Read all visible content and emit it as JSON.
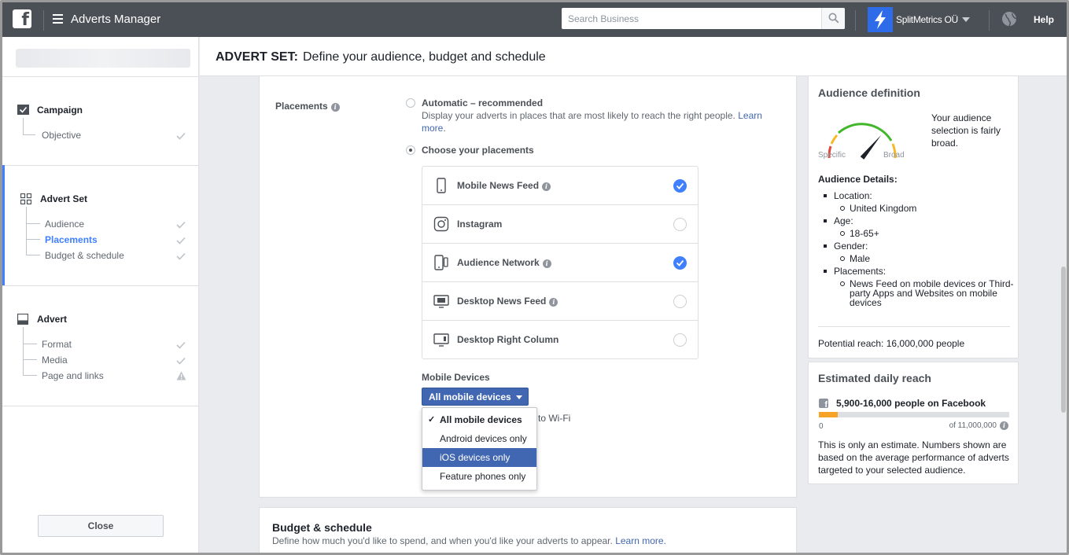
{
  "topbar": {
    "logo_letter": "f",
    "app_title": "Adverts Manager",
    "search_placeholder": "Search Business",
    "account_name": "SplitMetrics OÜ",
    "help_label": "Help"
  },
  "sidebar": {
    "sections": [
      {
        "label": "Campaign",
        "items": [
          {
            "label": "Objective",
            "status": "done"
          }
        ]
      },
      {
        "label": "Advert Set",
        "items": [
          {
            "label": "Audience",
            "status": "done"
          },
          {
            "label": "Placements",
            "status": "done",
            "active": true
          },
          {
            "label": "Budget & schedule",
            "status": "done"
          }
        ]
      },
      {
        "label": "Advert",
        "items": [
          {
            "label": "Format",
            "status": "done"
          },
          {
            "label": "Media",
            "status": "done"
          },
          {
            "label": "Page and links",
            "status": "warning"
          }
        ]
      }
    ],
    "close_label": "Close"
  },
  "header": {
    "prefix": "ADVERT SET:",
    "title": "Define your audience, budget and schedule"
  },
  "placements": {
    "label": "Placements",
    "automatic": {
      "title": "Automatic – recommended",
      "desc": "Display your adverts in places that are most likely to reach the right people.",
      "link": "Learn more",
      "link_suffix": "."
    },
    "choose_title": "Choose your placements",
    "options": [
      {
        "label": "Mobile News Feed",
        "info": true,
        "checked": true,
        "icon": "phone-icon"
      },
      {
        "label": "Instagram",
        "info": false,
        "checked": false,
        "icon": "instagram-icon"
      },
      {
        "label": "Audience Network",
        "info": true,
        "checked": true,
        "icon": "audience-network-icon"
      },
      {
        "label": "Desktop News Feed",
        "info": true,
        "checked": false,
        "icon": "desktop-icon"
      },
      {
        "label": "Desktop Right Column",
        "info": false,
        "checked": false,
        "icon": "desktop-right-column-icon"
      }
    ],
    "mobile_devices_label": "Mobile Devices",
    "mobile_devices_selected": "All mobile devices",
    "mobile_devices_options": [
      {
        "label": "All mobile devices",
        "selected": true
      },
      {
        "label": "Android devices only"
      },
      {
        "label": "iOS devices only",
        "highlighted": true
      },
      {
        "label": "Feature phones only"
      }
    ],
    "wifi_partial": "d to Wi-Fi"
  },
  "budget": {
    "title": "Budget & schedule",
    "desc": "Define how much you'd like to spend, and when you'd like your adverts to appear.",
    "link": "Learn more."
  },
  "audience_definition": {
    "title": "Audience definition",
    "gauge_left": "Specific",
    "gauge_right": "Broad",
    "gauge_level": 0.72,
    "summary": "Your audience selection is fairly broad.",
    "details_title": "Audience Details:",
    "details": [
      {
        "label": "Location:",
        "values": [
          "United Kingdom"
        ]
      },
      {
        "label": "Age:",
        "values": [
          "18-65+"
        ]
      },
      {
        "label": "Gender:",
        "values": [
          "Male"
        ]
      },
      {
        "label": "Placements:",
        "values": [
          "News Feed on mobile devices or Third-party Apps and Websites on mobile devices"
        ]
      }
    ],
    "potential_reach": "Potential reach: 16,000,000 people"
  },
  "estimated_reach": {
    "title": "Estimated daily reach",
    "people": "5,900-16,000 people on Facebook",
    "bar_fill_fraction": 0.1,
    "min_label": "0",
    "max_label": "of 11,000,000",
    "note": "This is only an estimate. Numbers shown are based on the average performance of adverts targeted to your selected audience."
  },
  "colors": {
    "topbar_bg": "#4b4f56",
    "accent_blue": "#4080ff",
    "button_blue": "#4267b2",
    "reach_bar": "#f7a328",
    "gauge_red": "#e0483c",
    "gauge_green": "#42b72a"
  }
}
